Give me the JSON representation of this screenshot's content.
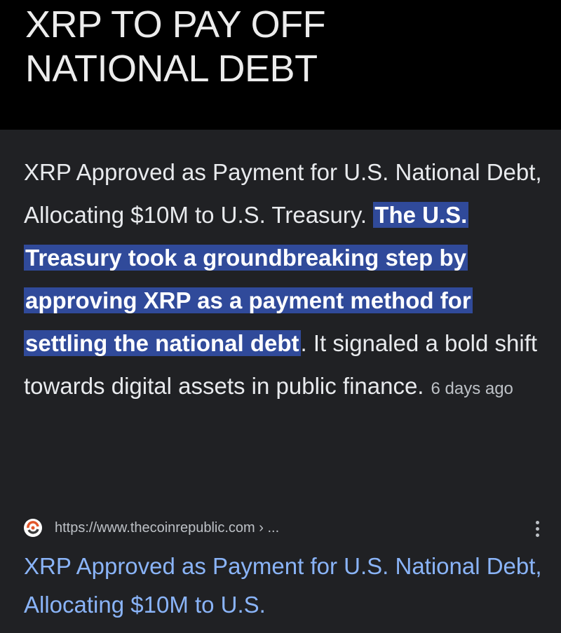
{
  "header": {
    "title_line1": "XRP TO PAY OFF",
    "title_line2": "NATIONAL DEBT"
  },
  "snippet": {
    "intro": "XRP Approved as Payment for U.S. National Debt, Allocating $10M to U.S. Treasury.",
    "highlight": "The U.S. Treasury took a groundbreaking step by approving XRP as a payment method for settling the national debt",
    "outro": ". It signaled a bold shift towards digital assets in public finance.",
    "date": "6 days ago",
    "highlight_color": "#304a9a"
  },
  "source": {
    "favicon_icon": "coinrepublic-logo-icon",
    "url": "https://www.thecoinrepublic.com › ...",
    "more_icon": "more-vert-icon"
  },
  "result": {
    "title": "XRP Approved as Payment for U.S. National Debt, Allocating $10M to U.S.",
    "link_color": "#8ab4f8"
  }
}
